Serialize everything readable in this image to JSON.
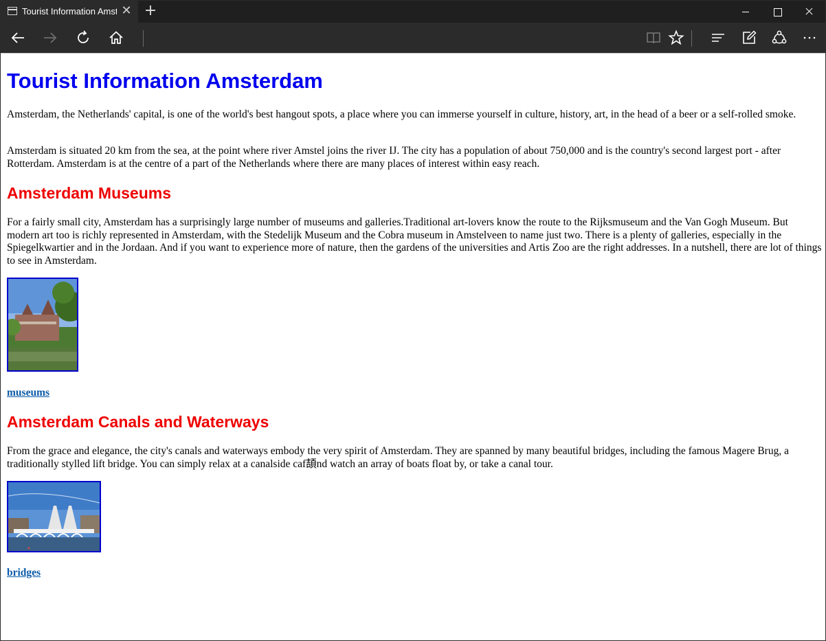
{
  "browser": {
    "tab_title": "Tourist Information Amsterdam",
    "tab_close": "✕",
    "new_tab": "+"
  },
  "page": {
    "title": "Tourist Information Amsterdam",
    "intro_1": "Amsterdam, the Netherlands' capital, is one of the world's best hangout spots, a place where you can immerse yourself in culture, history, art, in the head of a beer or a self-rolled smoke.",
    "intro_2": "Amsterdam is situated 20 km from the sea, at the point where river Amstel joins the river IJ. The city has a population of about 750,000 and is the country's second largest port - after Rotterdam. Amsterdam is at the centre of a part of the Netherlands where there are many places of interest within easy reach.",
    "museums": {
      "heading": "Amsterdam Museums",
      "text": "For a fairly small city, Amsterdam has a surprisingly large number of museums and galleries.Traditional art-lovers know the route to the Rijksmuseum and the Van Gogh Museum. But modern art too is richly represented in Amsterdam, with the Stedelijk Museum and the Cobra museum in Amstelveen to name just two. There is a plenty of galleries, especially in the Spiegelkwartier and in the Jordaan. And if you want to experience more of nature, then the gardens of the universities and Artis Zoo are the right addresses. In a nutshell, there are lot of things to see in Amsterdam.",
      "link": "museums"
    },
    "canals": {
      "heading": "Amsterdam Canals and Waterways",
      "text": "From the grace and elegance, the city's canals and waterways embody the very spirit of Amsterdam. They are spanned by many beautiful bridges, including the famous Magere Brug, a traditionally stylled lift bridge. You can simply relax at a canalside caf頡nd watch an array of boats float by, or take a canal tour.",
      "link": "bridges"
    }
  },
  "colors": {
    "title_blue": "#0000ee",
    "heading_red": "#ee0000",
    "link_blue": "#0b5aa8",
    "chrome_dark": "#2b2b2b"
  },
  "icons": [
    "tab-page-icon",
    "back-icon",
    "forward-icon",
    "refresh-icon",
    "home-icon",
    "reading-view-icon",
    "favorite-star-icon",
    "hub-icon",
    "web-note-icon",
    "share-icon",
    "more-icon"
  ]
}
